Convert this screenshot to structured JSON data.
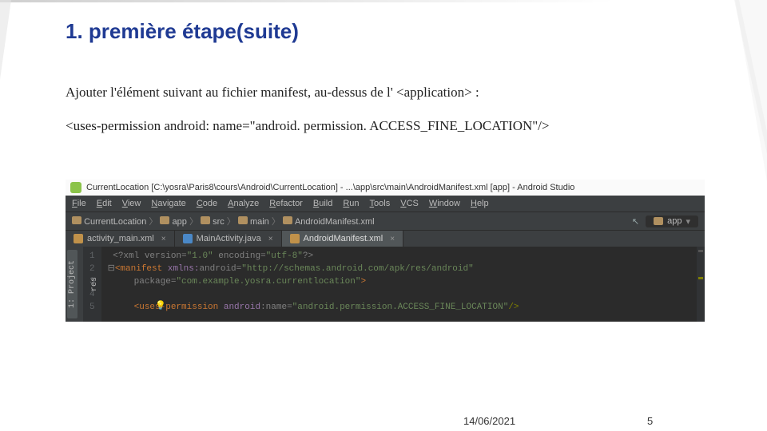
{
  "title": "1. première étape(suite)",
  "paragraph": "Ajouter l'élément suivant au fichier manifest, au-dessus de l' <application> :",
  "codeline": "<uses-permission android: name=\"android. permission. ACCESS_FINE_LOCATION\"/>",
  "ide": {
    "window_title": "CurrentLocation [C:\\yosra\\Paris8\\cours\\Android\\CurrentLocation] - ...\\app\\src\\main\\AndroidManifest.xml [app] - Android Studio",
    "menu": [
      "File",
      "Edit",
      "View",
      "Navigate",
      "Code",
      "Analyze",
      "Refactor",
      "Build",
      "Run",
      "Tools",
      "VCS",
      "Window",
      "Help"
    ],
    "crumbs": [
      "CurrentLocation",
      "app",
      "src",
      "main",
      "AndroidManifest.xml"
    ],
    "run_config": "app",
    "tabs": [
      {
        "label": "activity_main.xml",
        "active": false,
        "icon": "i-xml"
      },
      {
        "label": "MainActivity.java",
        "active": false,
        "icon": "i-java"
      },
      {
        "label": "AndroidManifest.xml",
        "active": true,
        "icon": "i-manifest"
      }
    ],
    "side_tabs": [
      "1: Project",
      "res"
    ],
    "gutter": [
      "1",
      "2",
      "3",
      "4",
      "5"
    ],
    "code_lines": [
      {
        "html": "<span class='c-gray'>&lt;?xml version=</span><span class='c-green'>\"1.0\"</span><span class='c-gray'> encoding=</span><span class='c-green'>\"utf-8\"</span><span class='c-gray'>?&gt;</span>"
      },
      {
        "html": "<span class='c-orange'>&lt;manifest </span><span class='c-attr'>xmlns:</span><span class='c-gray'>android=</span><span class='c-green'>\"http://schemas.android.com/apk/res/android\"</span>",
        "prefix": "⊟"
      },
      {
        "html": "    <span class='c-gray'>package=</span><span class='c-green'>\"com.example.yosra.currentlocation\"</span><span class='c-orange'>&gt;</span>"
      },
      {
        "html": ""
      },
      {
        "html": "    <span class='c-orange'>&lt;uses-permission </span><span class='c-attr'>android</span><span class='c-gray'>:name=</span><span class='c-green'>\"android.permission.ACCESS_FINE_LOCATION\"</span><span class='c-olive'>/&gt;</span>"
      }
    ]
  },
  "footer": {
    "date": "14/06/2021",
    "page": "5"
  }
}
